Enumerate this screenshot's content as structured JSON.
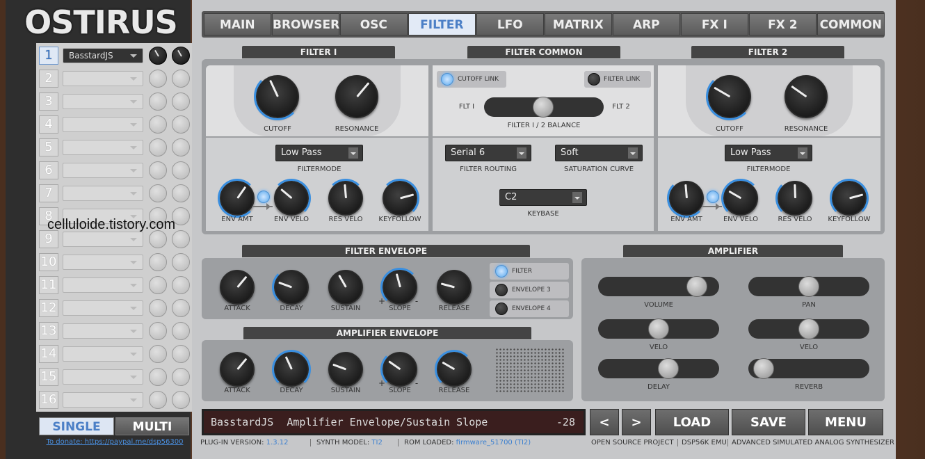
{
  "app": {
    "title": "OSTIRUS"
  },
  "sidebar": {
    "parts": [
      {
        "num": "1",
        "preset": "BasstardJS",
        "active": true
      },
      {
        "num": "2",
        "preset": ""
      },
      {
        "num": "3",
        "preset": ""
      },
      {
        "num": "4",
        "preset": ""
      },
      {
        "num": "5",
        "preset": ""
      },
      {
        "num": "6",
        "preset": ""
      },
      {
        "num": "7",
        "preset": ""
      },
      {
        "num": "8",
        "preset": ""
      },
      {
        "num": "9",
        "preset": ""
      },
      {
        "num": "10",
        "preset": ""
      },
      {
        "num": "11",
        "preset": ""
      },
      {
        "num": "12",
        "preset": ""
      },
      {
        "num": "13",
        "preset": ""
      },
      {
        "num": "14",
        "preset": ""
      },
      {
        "num": "15",
        "preset": ""
      },
      {
        "num": "16",
        "preset": ""
      }
    ],
    "mode_single": "SINGLE",
    "mode_multi": "MULTI",
    "donate": "To donate: https://paypal.me/dsp56300",
    "watermark": "celluloide.tistory.com"
  },
  "tabs": [
    "MAIN",
    "BROWSER",
    "OSC",
    "FILTER",
    "LFO",
    "MATRIX",
    "ARP",
    "FX I",
    "FX 2",
    "COMMON"
  ],
  "active_tab": "FILTER",
  "filter1": {
    "title": "FILTER I",
    "cutoff": "CUTOFF",
    "resonance": "RESONANCE",
    "mode_value": "Low Pass",
    "mode_label": "FILTERMODE",
    "env_amt": "ENV AMT",
    "env_velo": "ENV VELO",
    "res_velo": "RES VELO",
    "keyfollow": "KEYFOLLOW"
  },
  "filter_common": {
    "title": "FILTER COMMON",
    "cutoff_link": "CUTOFF LINK",
    "filter_link": "FILTER LINK",
    "flt1": "FLT I",
    "flt2": "FLT 2",
    "balance": "FILTER I / 2 BALANCE",
    "routing_value": "Serial 6",
    "routing_label": "FILTER ROUTING",
    "saturation_value": "Soft",
    "saturation_label": "SATURATION CURVE",
    "keybase_value": "C2",
    "keybase_label": "KEYBASE"
  },
  "filter2": {
    "title": "FILTER 2",
    "cutoff": "CUTOFF",
    "resonance": "RESONANCE",
    "mode_value": "Low Pass",
    "mode_label": "FILTERMODE",
    "env_amt": "ENV AMT",
    "env_velo": "ENV VELO",
    "res_velo": "RES VELO",
    "keyfollow": "KEYFOLLOW"
  },
  "filter_env": {
    "title": "FILTER ENVELOPE",
    "attack": "ATTACK",
    "decay": "DECAY",
    "sustain": "SUSTAIN",
    "slope": "SLOPE",
    "release": "RELEASE",
    "plus": "+",
    "minus": "-",
    "opt_filter": "FILTER",
    "opt_env3": "ENVELOPE 3",
    "opt_env4": "ENVELOPE 4"
  },
  "amp_env": {
    "title": "AMPLIFIER ENVELOPE",
    "attack": "ATTACK",
    "decay": "DECAY",
    "sustain": "SUSTAIN",
    "slope": "SLOPE",
    "release": "RELEASE",
    "plus": "+",
    "minus": "-"
  },
  "amplifier": {
    "title": "AMPLIFIER",
    "volume": "VOLUME",
    "pan": "PAN",
    "velo1": "VELO",
    "velo2": "VELO",
    "delay": "DELAY",
    "reverb": "REVERB",
    "volume_level": 0.88,
    "pan_level": 0.5,
    "velo1_level": 0.5,
    "velo2_level": 0.5,
    "delay_level": 0.6,
    "reverb_level": 0.05
  },
  "lcd": {
    "patch": "BasstardJS",
    "param": "Amplifier Envelope/Sustain Slope",
    "value": "-28"
  },
  "buttons": {
    "prev": "<",
    "next": ">",
    "load": "LOAD",
    "save": "SAVE",
    "menu": "MENU"
  },
  "status": {
    "plugin_label": "PLUG-IN VERSION:",
    "plugin_value": "1.3.12",
    "synth_label": "SYNTH MODEL:",
    "synth_value": "TI2",
    "rom_label": "ROM LOADED:",
    "rom_value": "firmware_51700 (TI2)",
    "osp": "OPEN SOURCE PROJECT",
    "dsp": "DSP56K EMU",
    "asas": "ADVANCED SIMULATED ANALOG SYNTHESIZER"
  },
  "colors": {
    "accent": "#4b7fc6",
    "panel": "#9d9fa2",
    "led_on": "#5aa9ee"
  }
}
